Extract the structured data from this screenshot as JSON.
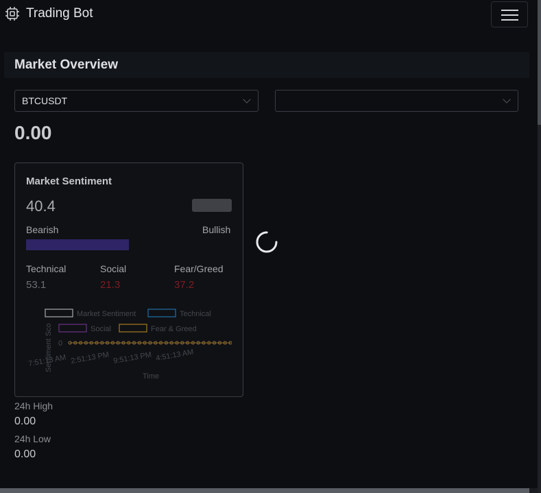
{
  "navbar": {
    "brand": "Trading Bot",
    "brand_icon": "cpu-icon",
    "menu_icon": "hamburger-icon"
  },
  "overview": {
    "title": "Market Overview",
    "symbol_select": {
      "value": "BTCUSDT"
    },
    "second_select": {
      "value": ""
    },
    "price": "0.00"
  },
  "sentiment": {
    "title": "Market Sentiment",
    "score": "40.4",
    "score_fill": 0.5,
    "bearish_label": "Bearish",
    "bullish_label": "Bullish",
    "metrics": [
      {
        "label": "Technical",
        "value": "53.1",
        "color": "#6d6f74"
      },
      {
        "label": "Social",
        "value": "21.3",
        "color": "#7a1f21"
      },
      {
        "label": "Fear/Greed",
        "value": "37.2",
        "color": "#7a1f21"
      }
    ]
  },
  "stats": {
    "high_label": "24h High",
    "high_value": "0.00",
    "low_label": "24h Low",
    "low_value": "0.00"
  },
  "colors": {
    "background": "#0d0e12",
    "bar_fill": "#2e2466",
    "negative": "#7a1f21"
  },
  "chart_data": {
    "type": "line",
    "xlabel": "Time",
    "ylabel": "Sentiment Sco",
    "x_ticks": [
      "7:51:13 AM",
      "2:51:13 PM",
      "9:51:13 PM",
      "4:51:13 AM"
    ],
    "y_ticks": [
      "0"
    ],
    "series": [
      {
        "name": "Market Sentiment",
        "color": "#8a8c90",
        "values": [
          0,
          0,
          0,
          0,
          0,
          0,
          0,
          0,
          0,
          0,
          0,
          0,
          0,
          0,
          0,
          0,
          0,
          0,
          0,
          0,
          0,
          0,
          0,
          0,
          0,
          0,
          0,
          0,
          0,
          0,
          0
        ]
      },
      {
        "name": "Technical",
        "color": "#1d5e8a",
        "values": [
          0,
          0,
          0,
          0,
          0,
          0,
          0,
          0,
          0,
          0,
          0,
          0,
          0,
          0,
          0,
          0,
          0,
          0,
          0,
          0,
          0,
          0,
          0,
          0,
          0,
          0,
          0,
          0,
          0,
          0,
          0
        ]
      },
      {
        "name": "Social",
        "color": "#5a2a6e",
        "values": [
          0,
          0,
          0,
          0,
          0,
          0,
          0,
          0,
          0,
          0,
          0,
          0,
          0,
          0,
          0,
          0,
          0,
          0,
          0,
          0,
          0,
          0,
          0,
          0,
          0,
          0,
          0,
          0,
          0,
          0,
          0
        ]
      },
      {
        "name": "Fear & Greed",
        "color": "#8a6620",
        "values": [
          0,
          0,
          0,
          0,
          0,
          0,
          0,
          0,
          0,
          0,
          0,
          0,
          0,
          0,
          0,
          0,
          0,
          0,
          0,
          0,
          0,
          0,
          0,
          0,
          0,
          0,
          0,
          0,
          0,
          0,
          0
        ]
      }
    ],
    "legend": "top"
  }
}
